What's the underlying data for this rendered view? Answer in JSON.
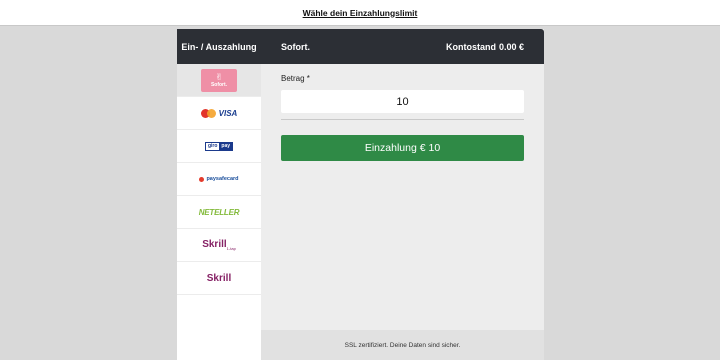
{
  "top_bar": {
    "link_text": "Wähle dein Einzahlungslimit"
  },
  "header": {
    "tab_label": "Ein- / Auszahlung",
    "method_title": "Sofort.",
    "balance_label": "Kontostand",
    "balance_value": "0.00 €"
  },
  "payment_methods": [
    {
      "name": "sofort",
      "label": "Sofort.",
      "icon": "hand-icon",
      "active": true
    },
    {
      "name": "visa-mastercard",
      "label": "VISA"
    },
    {
      "name": "giropay",
      "label_1": "giro",
      "label_2": "pay"
    },
    {
      "name": "paysafecard",
      "label": "paysafecard"
    },
    {
      "name": "neteller",
      "label": "NETELLER"
    },
    {
      "name": "skrill-1tap",
      "label": "Skrill",
      "suffix": "1-tap"
    },
    {
      "name": "skrill",
      "label": "Skrill"
    }
  ],
  "form": {
    "amount_label": "Betrag *",
    "amount_value": "10",
    "deposit_button_label": "Einzahlung € 10"
  },
  "footer": {
    "text": "SSL zertifiziert. Deine Daten sind sicher."
  },
  "colors": {
    "header_bg": "#2c2f35",
    "deposit_green": "#2f8a46",
    "sofort_pink": "#ef8fa6",
    "skrill_purple": "#862165",
    "neteller_green": "#83ba3b"
  }
}
